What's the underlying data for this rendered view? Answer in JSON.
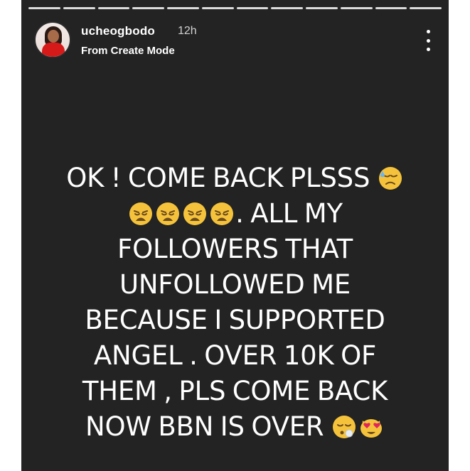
{
  "story": {
    "progress_segments": 12,
    "header": {
      "username": "ucheogbodo",
      "time": "12h",
      "subtitle": "From Create Mode"
    },
    "message": {
      "line1": "OK ! COME BACK PLSSS",
      "line2_suffix": ". ALL MY",
      "line3": "FOLLOWERS THAT",
      "line4": "UNFOLLOWED ME",
      "line5": "BECAUSE I SUPPORTED",
      "line6": "ANGEL . OVER 10K OF",
      "line7": "THEM , PLS COME BACK",
      "line8": "NOW BBN IS OVER"
    },
    "emojis": {
      "line1": [
        "downcast-face-with-sweat-icon"
      ],
      "line2": [
        "weary-face-icon",
        "weary-face-icon",
        "weary-face-icon",
        "weary-face-icon"
      ],
      "line8": [
        "face-exhaling-icon",
        "heart-eyes-cat-icon"
      ]
    }
  },
  "colors": {
    "story_background": "#232323",
    "text": "#ffffff",
    "avatar_dress": "#d61a1a"
  }
}
